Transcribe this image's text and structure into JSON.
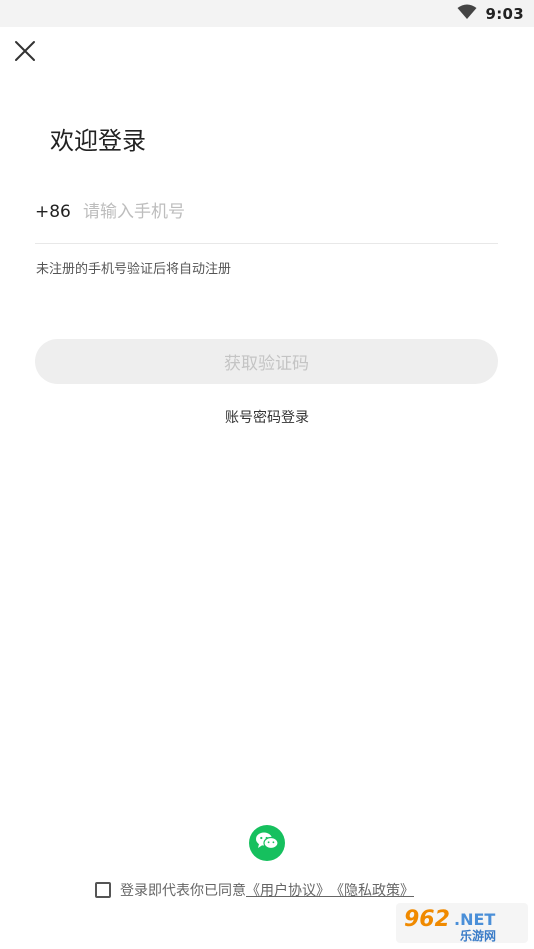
{
  "status_bar": {
    "time": "9:03"
  },
  "header": {
    "title": "欢迎登录"
  },
  "phone": {
    "country_code": "+86",
    "placeholder": "请输入手机号",
    "value": ""
  },
  "hint": "未注册的手机号验证后将自动注册",
  "buttons": {
    "get_code": "获取验证码",
    "password_login": "账号密码登录"
  },
  "agreement": {
    "prefix": "登录即代表你已同意",
    "user_agreement": "《用户协议》",
    "privacy_policy": "《隐私政策》",
    "checked": false
  },
  "watermark": {
    "brand": "962.NET",
    "sub": "乐游网"
  },
  "colors": {
    "wechat": "#16c05e",
    "button_disabled_bg": "#eeeeee",
    "button_disabled_text": "#c4c4c4"
  }
}
